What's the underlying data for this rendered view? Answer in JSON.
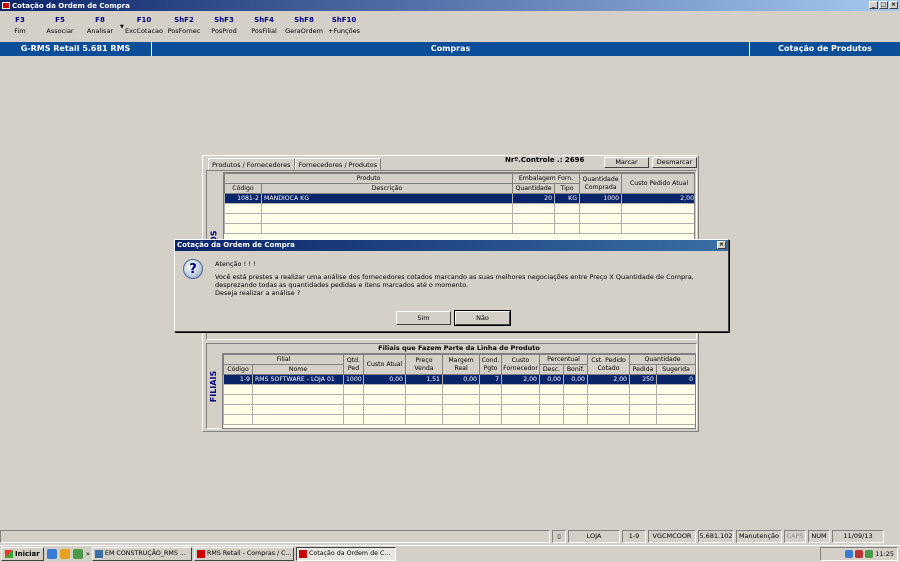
{
  "window": {
    "title": "Cotação da Ordem de Compra"
  },
  "fkeys": [
    {
      "key": "F3",
      "label": "Fim"
    },
    {
      "key": "F5",
      "label": "Associar"
    },
    {
      "key": "F8",
      "label": "Analisar"
    },
    {
      "key": "F10",
      "label": "ExcCotacao"
    },
    {
      "key": "ShF2",
      "label": "PosFornec"
    },
    {
      "key": "ShF3",
      "label": "PosProd"
    },
    {
      "key": "ShF4",
      "label": "PosFilial"
    },
    {
      "key": "ShF8",
      "label": "GeraOrdem"
    },
    {
      "key": "ShF10",
      "label": "+Funções"
    }
  ],
  "header": {
    "left": "G-RMS Retail 5.681 RMS",
    "center": "Compras",
    "right": "Cotação de Produtos"
  },
  "panel": {
    "tabs": [
      "Produtos / Fornecedores",
      "Fornecedores / Produtos"
    ],
    "controle_label": "Nrº.Controle .: 2696",
    "marcar": "Marcar",
    "desmarcar": "Desmarcar"
  },
  "produtos": {
    "side_label": "PRODUTOS",
    "h_produto": "Produto",
    "h_embalagem": "Embalagem Forn.",
    "h_qtd_comprada": "Quantidade Comprada",
    "h_custo_pedido": "Custo Pedido Atual",
    "h_codigo": "Código",
    "h_descricao": "Descrição",
    "h_quantidade": "Quantidade",
    "h_tipo": "Tipo",
    "row": {
      "codigo": "1081-2",
      "descricao": "MANDIOCA KG",
      "quantidade": "20",
      "tipo": "KG",
      "comprada": "1000",
      "custo": "2,00"
    }
  },
  "filiais": {
    "side_label": "FILIAIS",
    "title": "Filiais que Fazem Parte da Linha do Produto",
    "h_filial": "Filial",
    "h_qtd_ped": "Qtd. Ped",
    "h_custo_atual": "Custo Atual",
    "h_preco_venda": "Preço Venda",
    "h_margem_real": "Margem Real",
    "h_cond_pgto": "Cond. Pgto",
    "h_custo_fornecedor": "Custo Fornecedor",
    "h_percentual": "Percentual",
    "h_cst_pedido_cotado": "Cst. Pedido Cotado",
    "h_quantidade": "Quantidade",
    "h_codigo": "Código",
    "h_nome": "Nome",
    "h_desc": "Desc.",
    "h_bonif": "Bonif.",
    "h_pedida": "Pedida",
    "h_sugerida": "Sugerida",
    "row": {
      "codigo": "1-9",
      "nome": "RMS SOFTWARE - LOJA 01",
      "qtd": "1000",
      "custo_atual": "0,00",
      "preco_venda": "1,51",
      "margem": "0,00",
      "cond": "7",
      "custo_forn": "2,00",
      "desc": "0,00",
      "bonif": "0,00",
      "cst_pedido": "2,00",
      "pedida": "250",
      "sugerida": "0"
    }
  },
  "dialog": {
    "title": "Cotação da Ordem de Compra",
    "line1": "Atenção ! ! !",
    "line2": "Você está prestes a realizar uma análise dos fornecedores cotados marcando as suas melhores negociações entre Preço X Quantidade de Compra, desprezando todas as quantidades pedidas e itens marcados até o momento.",
    "line3": "Deseja realizar a análise ?",
    "yes": "Sim",
    "no": "Não"
  },
  "status": {
    "loja": "LOJA",
    "codigo": "1-9",
    "user": "VGCMCOOR",
    "version": "5.681.102",
    "mode": "Manutenção",
    "caps": "CAPS",
    "num": "NUM",
    "date": "11/09/13"
  },
  "taskbar": {
    "start": "Iniciar",
    "tasks": [
      "EM CONSTRUÇÃO_RMS ...",
      "RMS Retail - Compras / C...",
      "Cotação da Ordem de C..."
    ],
    "time": "11:25"
  }
}
